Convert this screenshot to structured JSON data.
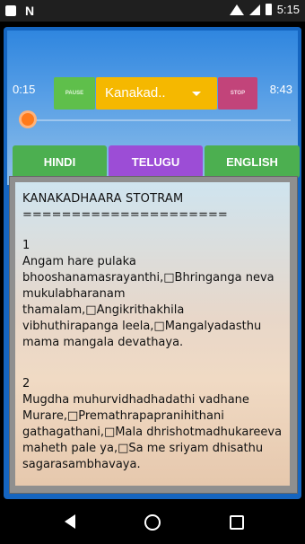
{
  "status_bar": {
    "time": "5:15",
    "icons": [
      "square-icon",
      "n-icon",
      "wifi-icon",
      "signal-icon",
      "battery-icon"
    ]
  },
  "player": {
    "elapsed": "0:15",
    "duration": "8:43",
    "pause_label": "PAUSE",
    "stop_label": "STOP",
    "selected_track": "Kanakad..",
    "progress_fraction": 0.03
  },
  "tabs": [
    {
      "label": "HINDI"
    },
    {
      "label": "TELUGU"
    },
    {
      "label": "ENGLISH"
    }
  ],
  "lyrics": {
    "title": "KANAKADHAARA STOTRAM",
    "rule": "=====================",
    "verses": [
      {
        "number": "1",
        "text": "Angam hare pulaka bhooshanamasrayanthi,□Bhringanga neva mukulabharanam thamalam,□Angikrithakhila vibhuthirapanga leela,□Mangalyadasthu mama mangala devathaya."
      },
      {
        "number": "2",
        "text": "Mugdha muhurvidhadhadathi vadhane Murare,□Premathrapapranihithani gathagathani,□Mala dhrishotmadhukareeva maheth pale ya,□Sa me sriyam dhisathu sagarasambhavaya."
      }
    ]
  },
  "colors": {
    "header_blue": "#2f86df",
    "green_button": "#5fbf4b",
    "stop_button": "#c2447a",
    "dropdown": "#f5b800",
    "selected_tab": "#9c4dd6",
    "slider_thumb": "#ff7a1a"
  }
}
